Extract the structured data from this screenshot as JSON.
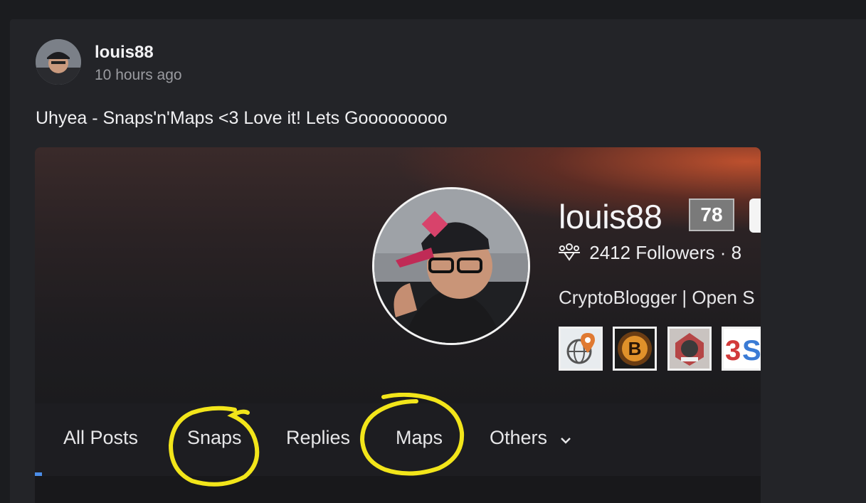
{
  "post": {
    "author": "louis88",
    "time": "10 hours ago",
    "text": "Uhyea - Snaps'n'Maps <3 Love it! Lets Gooooooooo"
  },
  "profile": {
    "name": "louis88",
    "reputation": "78",
    "followers_text": "2412 Followers · 8",
    "bio": "CryptoBlogger | Open S"
  },
  "tabs": [
    {
      "label": "All Posts"
    },
    {
      "label": "Snaps"
    },
    {
      "label": "Replies"
    },
    {
      "label": "Maps"
    },
    {
      "label": "Others"
    }
  ],
  "icons": {
    "followers": "followers-icon",
    "dropdown": "chevron-down-icon"
  },
  "colors": {
    "background": "#1b1c1f",
    "card": "#232428",
    "tab_indicator": "#4b8de8",
    "highlight": "#f2e51a"
  }
}
